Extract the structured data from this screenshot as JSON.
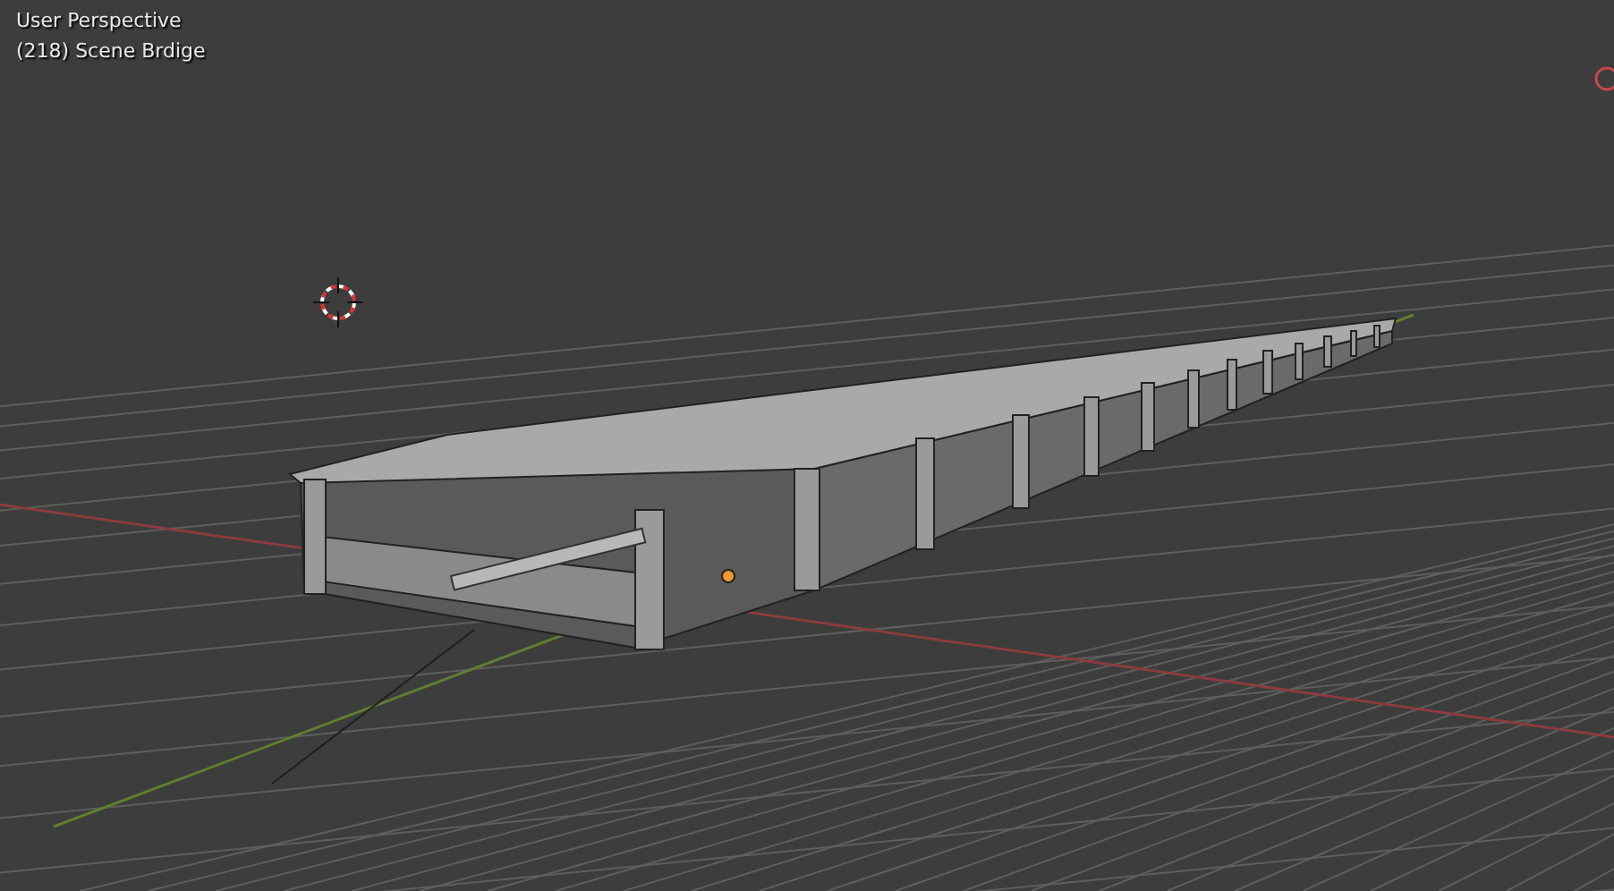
{
  "viewport": {
    "view_name": "User Perspective",
    "scene_info": "(218) Scene Brdige"
  }
}
